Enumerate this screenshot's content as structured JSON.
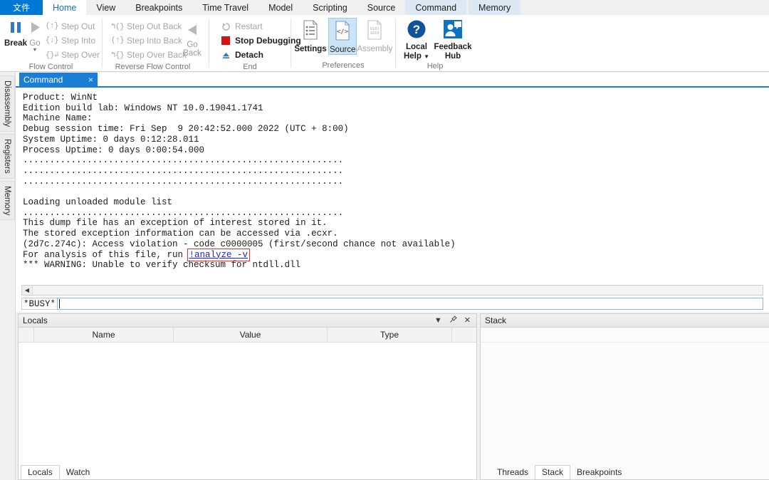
{
  "ribbon": {
    "tabs": [
      {
        "label": "文件",
        "kind": "file"
      },
      {
        "label": "Home",
        "kind": "active"
      },
      {
        "label": "View",
        "kind": "normal"
      },
      {
        "label": "Breakpoints",
        "kind": "normal"
      },
      {
        "label": "Time Travel",
        "kind": "normal"
      },
      {
        "label": "Model",
        "kind": "normal"
      },
      {
        "label": "Scripting",
        "kind": "normal"
      },
      {
        "label": "Source",
        "kind": "normal"
      },
      {
        "label": "Command",
        "kind": "ctx"
      },
      {
        "label": "Memory",
        "kind": "ctx"
      }
    ],
    "groups": {
      "flow_control": {
        "label": "Flow Control",
        "break_label": "Break",
        "go_label": "Go",
        "step_out": "Step Out",
        "step_into": "Step Into",
        "step_over": "Step Over"
      },
      "reverse_flow": {
        "label": "Reverse Flow Control",
        "step_out_back": "Step Out Back",
        "step_into_back": "Step Into Back",
        "step_over_back": "Step Over Back",
        "go_back_line1": "Go",
        "go_back_line2": "Back"
      },
      "end": {
        "label": "End",
        "restart": "Restart",
        "stop_debugging": "Stop Debugging",
        "detach": "Detach"
      },
      "preferences": {
        "label": "Preferences",
        "settings": "Settings",
        "source": "Source",
        "assembly": "Assembly"
      },
      "help": {
        "label": "Help",
        "local_help_line1": "Local",
        "local_help_line2": "Help",
        "feedback_line1": "Feedback",
        "feedback_line2": "Hub"
      }
    }
  },
  "side_tabs": [
    {
      "label": "Disassembly"
    },
    {
      "label": "Registers"
    },
    {
      "label": "Memory"
    }
  ],
  "command_panel": {
    "tab_label": "Command",
    "close_glyph": "×",
    "clipped_line": "...................................................",
    "output_lines": [
      {
        "text": "Product: WinNt"
      },
      {
        "text": "Edition build lab: Windows NT 10.0.19041.1741"
      },
      {
        "text": "Machine Name:"
      },
      {
        "text": "Debug session time: Fri Sep  9 20:42:52.000 2022 (UTC + 8:00)"
      },
      {
        "text": "System Uptime: 0 days 0:12:28.011"
      },
      {
        "text": "Process Uptime: 0 days 0:00:54.000"
      },
      {
        "text": "............................................................"
      },
      {
        "text": "............................................................"
      },
      {
        "text": "............................................................"
      },
      {
        "text": ""
      },
      {
        "text": "Loading unloaded module list"
      },
      {
        "text": "............................................................"
      },
      {
        "text": "This dump file has an exception of interest stored in it."
      },
      {
        "text": "The stored exception information can be accessed via .ecxr."
      },
      {
        "text": "(2d7c.274c): Access violation - code c0000005 (first/second chance not available)"
      }
    ],
    "analyze_line_prefix": "For analysis of this file, run ",
    "analyze_link": "!analyze -v",
    "warning_line": "*** WARNING: Unable to verify checksum for ntdll.dll",
    "prompt_status": "*BUSY*",
    "prompt_value": "",
    "scroll_left_glyph": "◀"
  },
  "locals_pane": {
    "title": "Locals",
    "menu_glyph": "▼",
    "pin_glyph": "📌",
    "close_glyph": "✕",
    "columns": [
      "Name",
      "Value",
      "Type"
    ],
    "rows": []
  },
  "stack_pane": {
    "title": "Stack",
    "rows": []
  },
  "bottom_tabs_left": [
    {
      "label": "Locals",
      "active": true
    },
    {
      "label": "Watch",
      "active": false
    }
  ],
  "bottom_tabs_right": [
    {
      "label": "Threads",
      "active": false
    },
    {
      "label": "Stack",
      "active": true
    },
    {
      "label": "Breakpoints",
      "active": false
    }
  ],
  "colors": {
    "accent_blue": "#0078d4",
    "tab_blue": "#1a7fd4",
    "context_tab": "#dce9f5",
    "link_blue": "#2020d0",
    "highlight_red": "#e03030",
    "stop_red": "#d41414"
  }
}
